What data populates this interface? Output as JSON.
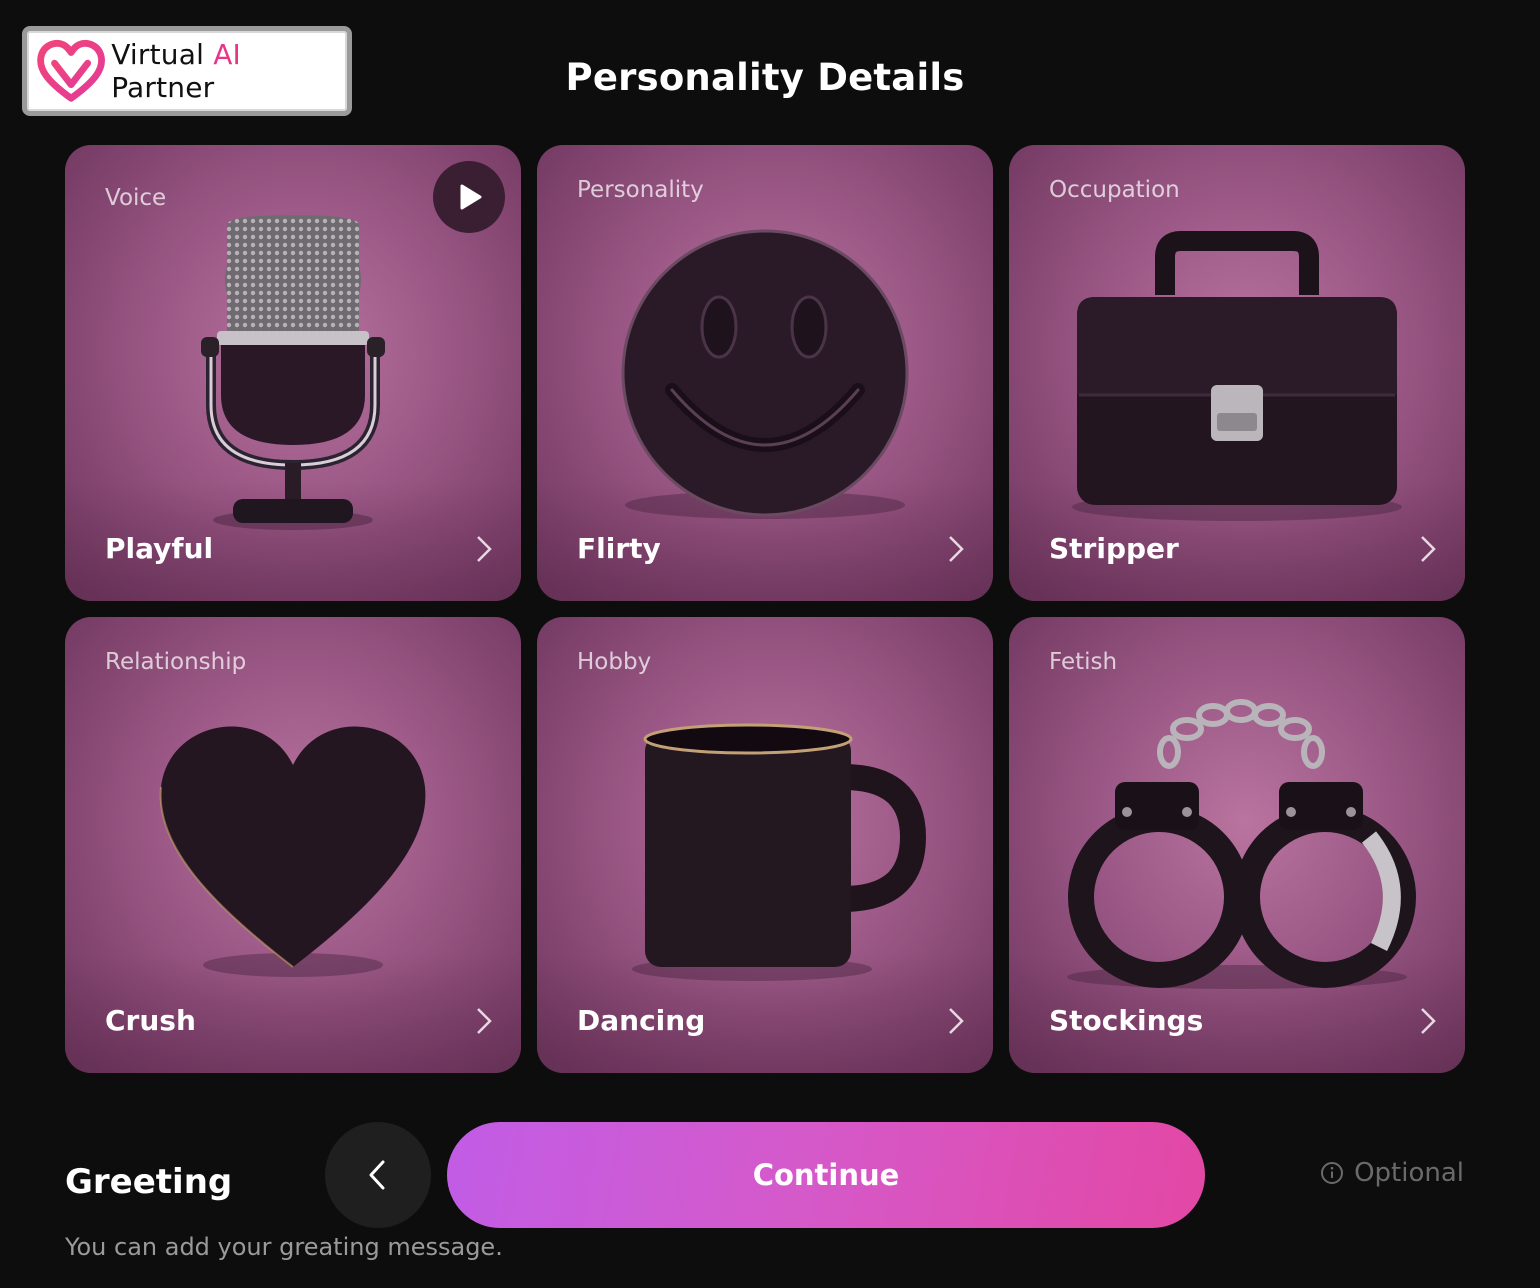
{
  "logo": {
    "text_before": "Virtual ",
    "text_ai": "AI",
    "text_after": " Partner"
  },
  "header": {
    "title": "Personality Details"
  },
  "cards": [
    {
      "category": "Voice",
      "value": "Playful",
      "icon": "microphone-icon",
      "has_play": true
    },
    {
      "category": "Personality",
      "value": "Flirty",
      "icon": "smiley-icon"
    },
    {
      "category": "Occupation",
      "value": "Stripper",
      "icon": "briefcase-icon"
    },
    {
      "category": "Relationship",
      "value": "Crush",
      "icon": "heart-icon"
    },
    {
      "category": "Hobby",
      "value": "Dancing",
      "icon": "mug-icon"
    },
    {
      "category": "Fetish",
      "value": "Stockings",
      "icon": "handcuffs-icon"
    }
  ],
  "greeting": {
    "title": "Greeting",
    "description": "You can add your greating message."
  },
  "actions": {
    "continue_label": "Continue",
    "optional_label": "Optional"
  },
  "colors": {
    "accent_start": "#c15ce6",
    "accent_end": "#e347a4",
    "card_bg": "#9a5785"
  }
}
